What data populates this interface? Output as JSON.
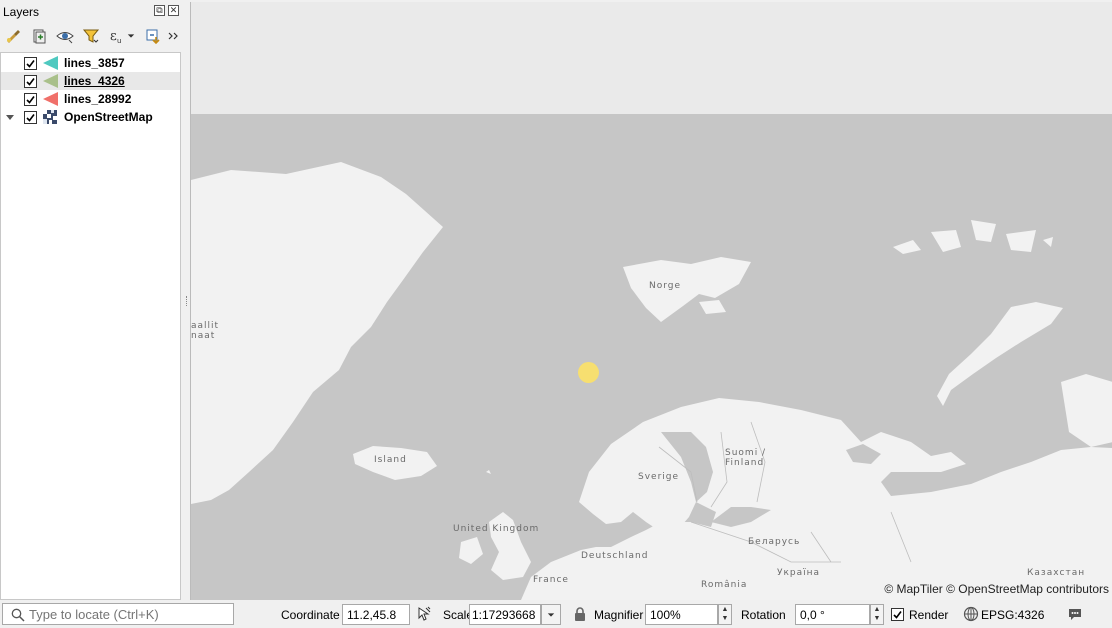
{
  "layers_panel": {
    "title": "Layers",
    "toolbar_icons": [
      "style-manager-icon",
      "add-group-icon",
      "visibility-icon",
      "filter-legend-icon",
      "filter-expression-icon",
      "expand-all-icon",
      "more-icon"
    ],
    "layers": [
      {
        "name": "lines_3857",
        "checked": true,
        "color": "#4fc9c0",
        "type": "vector-line"
      },
      {
        "name": "lines_4326",
        "checked": true,
        "color": "#a9c08a",
        "type": "vector-line",
        "selected": true
      },
      {
        "name": "lines_28992",
        "checked": true,
        "color": "#f0706a",
        "type": "vector-line"
      },
      {
        "name": "OpenStreetMap",
        "checked": true,
        "type": "raster-tiles",
        "expandable": true
      }
    ]
  },
  "map": {
    "labels": {
      "greenland": "aallit\nnaat",
      "norge": "Norge",
      "island": "Island",
      "sverige": "Sverige",
      "suomi": "Suomi /\nFinland",
      "united_kingdom": "United Kingdom",
      "deutschland": "Deutschland",
      "belarus": "Беларусь",
      "france": "France",
      "romania": "România",
      "ukraina": "Україна",
      "kazakhstan": "Казахстан"
    },
    "attribution": "© MapTiler  © OpenStreetMap contributors",
    "colors": {
      "water": "#c6c6c6",
      "land": "#f2f2f2",
      "void": "#eaeaea",
      "marker": "#f7df70"
    }
  },
  "statusbar": {
    "locator_placeholder": "Type to locate (Ctrl+K)",
    "coordinate_label": "Coordinate",
    "coordinate_value": "11.2,45.8",
    "scale_label": "Scale",
    "scale_value": "1:17293668",
    "magnifier_label": "Magnifier",
    "magnifier_value": "100%",
    "rotation_label": "Rotation",
    "rotation_value": "0,0 °",
    "render_label": "Render",
    "render_checked": true,
    "crs_label": "EPSG:4326"
  }
}
